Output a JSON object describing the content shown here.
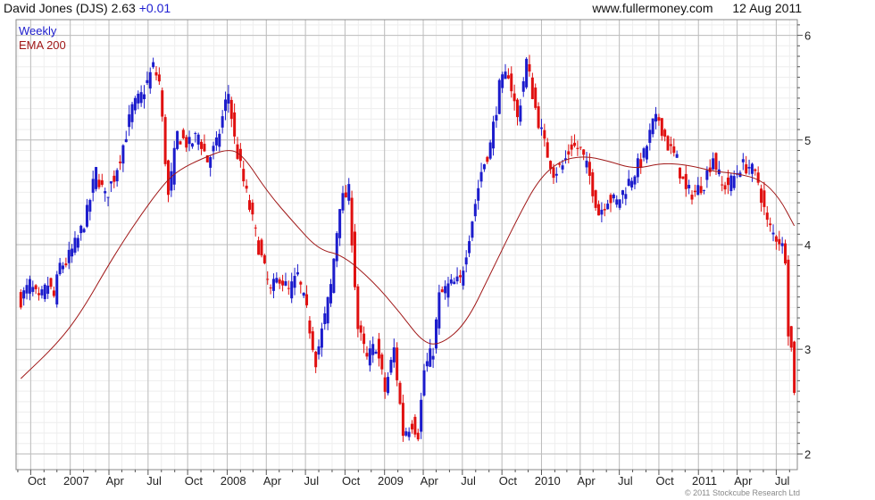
{
  "header": {
    "title": "David Jones (DJS) 2.63",
    "change": "+0.01",
    "site": "www.fullermoney.com",
    "date": "12 Aug 2011"
  },
  "legend": {
    "weekly": "Weekly",
    "ema": "EMA 200"
  },
  "footer": {
    "copyright": "© 2011 Stockcube Research Ltd"
  },
  "colors": {
    "up": "#1c1ccc",
    "down": "#e01010",
    "ema": "#a01818",
    "grid_major": "#bdbdbd",
    "grid_minor": "#eeeeee",
    "frame": "#888888",
    "header_change": "#1d1dd1"
  },
  "chart_data": {
    "type": "candlestick",
    "frequency": "weekly",
    "x_ticks": [
      "Oct",
      "2007",
      "Apr",
      "Jul",
      "Oct",
      "2008",
      "Apr",
      "Jul",
      "Oct",
      "2009",
      "Apr",
      "Jul",
      "Oct",
      "2010",
      "Apr",
      "Jul",
      "Oct",
      "2011",
      "Apr",
      "Jul"
    ],
    "y_ticks": [
      2,
      3,
      4,
      5,
      6
    ],
    "ylim": [
      1.85,
      6.15
    ],
    "y_axis": "right",
    "grid": true,
    "price_anchors": [
      [
        "2006-09-08",
        3.48
      ],
      [
        "2006-09-29",
        3.62
      ],
      [
        "2006-10-20",
        3.45
      ],
      [
        "2006-11-10",
        3.62
      ],
      [
        "2006-11-24",
        3.5
      ],
      [
        "2006-12-08",
        3.8
      ],
      [
        "2006-12-22",
        3.83
      ],
      [
        "2007-01-19",
        4.05
      ],
      [
        "2007-02-09",
        4.3
      ],
      [
        "2007-03-02",
        4.7
      ],
      [
        "2007-03-23",
        4.45
      ],
      [
        "2007-04-13",
        4.65
      ],
      [
        "2007-05-04",
        4.95
      ],
      [
        "2007-05-25",
        5.3
      ],
      [
        "2007-06-15",
        5.42
      ],
      [
        "2007-06-29",
        5.55
      ],
      [
        "2007-07-13",
        5.7
      ],
      [
        "2007-07-27",
        5.55
      ],
      [
        "2007-08-17",
        4.45
      ],
      [
        "2007-09-07",
        5.05
      ],
      [
        "2007-10-05",
        4.95
      ],
      [
        "2007-10-26",
        5.05
      ],
      [
        "2007-11-16",
        4.8
      ],
      [
        "2007-12-07",
        4.95
      ],
      [
        "2007-12-28",
        5.35
      ],
      [
        "2008-01-04",
        5.45
      ],
      [
        "2008-01-18",
        5.0
      ],
      [
        "2008-02-08",
        4.6
      ],
      [
        "2008-03-07",
        4.1
      ],
      [
        "2008-03-28",
        3.75
      ],
      [
        "2008-04-11",
        3.55
      ],
      [
        "2008-05-02",
        3.7
      ],
      [
        "2008-05-23",
        3.55
      ],
      [
        "2008-06-13",
        3.7
      ],
      [
        "2008-07-04",
        3.35
      ],
      [
        "2008-07-25",
        2.9
      ],
      [
        "2008-08-15",
        3.3
      ],
      [
        "2008-08-29",
        3.6
      ],
      [
        "2008-09-19",
        4.4
      ],
      [
        "2008-10-10",
        4.5
      ],
      [
        "2008-10-31",
        3.2
      ],
      [
        "2008-11-21",
        2.9
      ],
      [
        "2008-12-12",
        3.05
      ],
      [
        "2009-01-02",
        2.6
      ],
      [
        "2009-01-23",
        3.0
      ],
      [
        "2009-02-13",
        2.2
      ],
      [
        "2009-03-06",
        2.3
      ],
      [
        "2009-03-20",
        2.2
      ],
      [
        "2009-04-03",
        2.8
      ],
      [
        "2009-04-24",
        3.0
      ],
      [
        "2009-05-08",
        3.5
      ],
      [
        "2009-05-29",
        3.6
      ],
      [
        "2009-06-26",
        3.65
      ],
      [
        "2009-07-17",
        4.1
      ],
      [
        "2009-08-14",
        4.7
      ],
      [
        "2009-09-04",
        4.95
      ],
      [
        "2009-09-25",
        5.5
      ],
      [
        "2009-10-16",
        5.65
      ],
      [
        "2009-11-06",
        5.2
      ],
      [
        "2009-11-27",
        5.75
      ],
      [
        "2009-12-18",
        5.3
      ],
      [
        "2010-01-08",
        4.95
      ],
      [
        "2010-01-29",
        4.7
      ],
      [
        "2010-02-19",
        4.75
      ],
      [
        "2010-03-12",
        4.95
      ],
      [
        "2010-04-02",
        4.9
      ],
      [
        "2010-04-23",
        4.65
      ],
      [
        "2010-05-14",
        4.3
      ],
      [
        "2010-06-04",
        4.45
      ],
      [
        "2010-06-25",
        4.4
      ],
      [
        "2010-07-16",
        4.55
      ],
      [
        "2010-08-06",
        4.7
      ],
      [
        "2010-08-27",
        4.85
      ],
      [
        "2010-09-17",
        5.15
      ],
      [
        "2010-10-01",
        5.2
      ],
      [
        "2010-10-22",
        4.95
      ],
      [
        "2010-11-12",
        4.8
      ],
      [
        "2010-12-03",
        4.5
      ],
      [
        "2010-12-24",
        4.5
      ],
      [
        "2011-01-14",
        4.6
      ],
      [
        "2011-02-04",
        4.85
      ],
      [
        "2011-02-25",
        4.55
      ],
      [
        "2011-03-18",
        4.6
      ],
      [
        "2011-04-08",
        4.75
      ],
      [
        "2011-04-29",
        4.75
      ],
      [
        "2011-05-20",
        4.6
      ],
      [
        "2011-06-10",
        4.2
      ],
      [
        "2011-06-24",
        4.1
      ],
      [
        "2011-07-08",
        4.05
      ],
      [
        "2011-07-22",
        3.9
      ],
      [
        "2011-07-29",
        3.2
      ],
      [
        "2011-08-05",
        3.0
      ],
      [
        "2011-08-12",
        2.63
      ]
    ],
    "series": [
      {
        "name": "Weekly",
        "up_color": "#1c1ccc",
        "down_color": "#e01010"
      },
      {
        "name": "EMA 200",
        "color": "#a01818",
        "points": [
          [
            "2006-09-08",
            2.72
          ],
          [
            "2006-12-01",
            3.05
          ],
          [
            "2007-01-26",
            3.35
          ],
          [
            "2007-04-06",
            3.85
          ],
          [
            "2007-06-08",
            4.25
          ],
          [
            "2007-08-10",
            4.6
          ],
          [
            "2007-09-14",
            4.72
          ],
          [
            "2007-11-02",
            4.82
          ],
          [
            "2008-01-04",
            4.92
          ],
          [
            "2008-02-08",
            4.85
          ],
          [
            "2008-04-04",
            4.5
          ],
          [
            "2008-06-06",
            4.2
          ],
          [
            "2008-08-01",
            3.95
          ],
          [
            "2008-09-26",
            3.9
          ],
          [
            "2008-12-05",
            3.65
          ],
          [
            "2009-02-06",
            3.35
          ],
          [
            "2009-04-03",
            3.05
          ],
          [
            "2009-05-15",
            3.05
          ],
          [
            "2009-07-10",
            3.25
          ],
          [
            "2009-09-04",
            3.72
          ],
          [
            "2009-11-06",
            4.25
          ],
          [
            "2009-12-25",
            4.62
          ],
          [
            "2010-02-12",
            4.8
          ],
          [
            "2010-04-09",
            4.85
          ],
          [
            "2010-06-04",
            4.8
          ],
          [
            "2010-08-06",
            4.72
          ],
          [
            "2010-10-08",
            4.78
          ],
          [
            "2010-12-10",
            4.76
          ],
          [
            "2011-02-04",
            4.7
          ],
          [
            "2011-04-01",
            4.68
          ],
          [
            "2011-05-27",
            4.62
          ],
          [
            "2011-07-08",
            4.45
          ],
          [
            "2011-08-12",
            4.18
          ]
        ]
      }
    ]
  }
}
